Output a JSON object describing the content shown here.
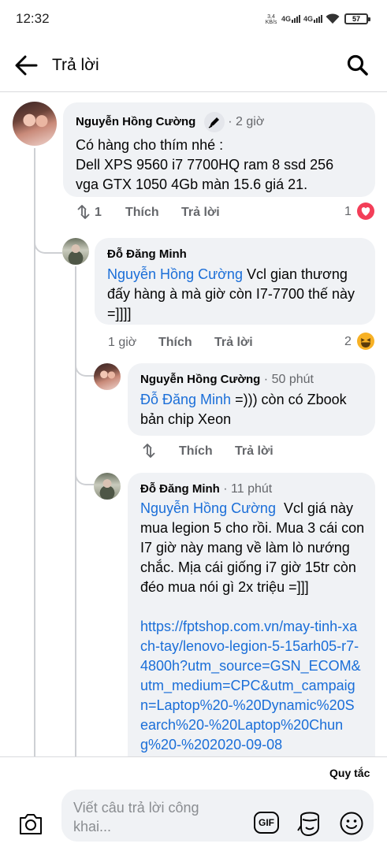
{
  "status_bar": {
    "time": "12:32",
    "speed_value": "3,4",
    "speed_unit": "KB/s",
    "network_1": "4G",
    "network_2": "4G",
    "battery": "57"
  },
  "header": {
    "title": "Trả lời",
    "back_icon": "arrow-left-icon",
    "search_icon": "search-icon"
  },
  "comments": [
    {
      "author": "Nguyễn Hồng Cường",
      "time": "· 2 giờ",
      "badge_icon": "pen-badge-icon",
      "text": "Có hàng cho thím nhé :\nDell XPS 9560 i7 7700HQ ram 8 ssd 256 vga GTX 1050 4Gb màn 15.6 giá 21.",
      "actions": {
        "shares": "1",
        "like": "Thích",
        "reply": "Trả lời"
      },
      "reactions": {
        "count": "1",
        "type": "love"
      }
    },
    {
      "author": "Đỗ Đăng Minh",
      "mention": "Nguyễn Hồng Cường",
      "text": " Vcl gian thương đấy hàng à mà giờ còn I7-7700 thế này =]]]]",
      "actions": {
        "time": "1 giờ",
        "like": "Thích",
        "reply": "Trả lời"
      },
      "reactions": {
        "count": "2",
        "type": "haha"
      }
    },
    {
      "author": "Nguyễn Hồng Cường",
      "time": "· 50 phút",
      "mention": "Đỗ Đăng Minh",
      "text": " =))) còn có Zbook bản chip Xeon",
      "actions": {
        "like": "Thích",
        "reply": "Trả lời"
      }
    },
    {
      "author": "Đỗ Đăng Minh",
      "time": "· 11 phút",
      "mention": "Nguyễn Hồng Cường",
      "text": "  Vcl giá này mua legion 5 cho rồi. Mua 3 cái con I7 giờ này mang về làm lò nướng chắc. Mịa cái giống i7 giờ 15tr còn đéo mua nói gì 2x triệu =]]]",
      "link": "https://fptshop.com.vn/may-tinh-xach-tay/lenovo-legion-5-15arh05-r7-4800h?utm_source=GSN_ECOM&utm_medium=CPC&utm_campaign=Laptop%20-%20Dynamic%20Search%20-%20Laptop%20Chung%20-%202020-09-08"
    }
  ],
  "footer": {
    "rules": "Quy tắc",
    "placeholder": "Viết câu trả lời công khai...",
    "gif_label": "GIF"
  },
  "colors": {
    "link": "#1a6ed8",
    "bubble": "#f0f2f5",
    "secondary_text": "#65676b",
    "love": "#f33e58",
    "haha": "#f7b125"
  }
}
